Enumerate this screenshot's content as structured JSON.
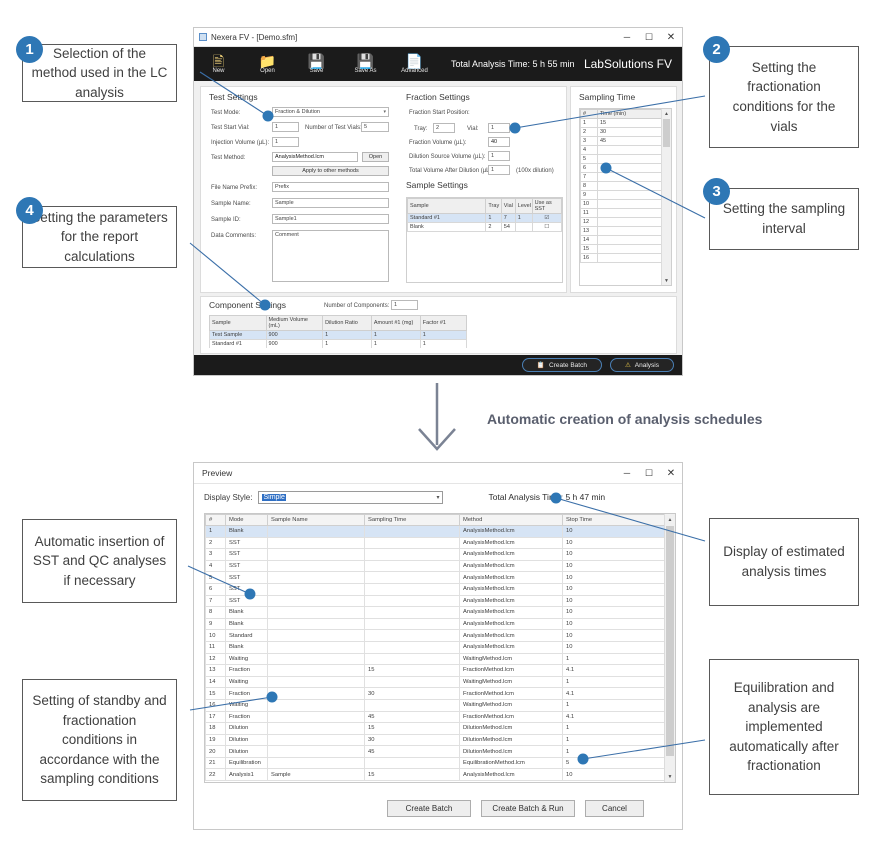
{
  "main_window": {
    "title": "Nexera FV - [Demo.sfm]",
    "window_buttons": {
      "minimize": "─",
      "maximize": "☐",
      "close": "✕"
    },
    "ribbon": {
      "items": [
        {
          "label": "New",
          "icon": "new-document-icon"
        },
        {
          "label": "Open",
          "icon": "folder-open-icon"
        },
        {
          "label": "Save",
          "icon": "floppy-disk-icon"
        },
        {
          "label": "Save As",
          "icon": "floppy-disk-plus-icon"
        },
        {
          "label": "Advanced",
          "icon": "advanced-settings-icon"
        }
      ],
      "total_analysis_time": "Total Analysis Time: 5 h 55 min",
      "brand": "LabSolutions FV"
    },
    "test_settings": {
      "title": "Test Settings",
      "test_mode_label": "Test Mode:",
      "test_mode_value": "Fraction & Dilution",
      "test_start_vial_label": "Test Start Vial:",
      "test_start_vial_value": "1",
      "number_of_test_vials_label": "Number of Test Vials:",
      "number_of_test_vials_value": "5",
      "injection_volume_label": "Injection Volume (µL):",
      "injection_volume_value": "1",
      "test_method_label": "Test Method:",
      "test_method_value": "AnalysisMethod.lcm",
      "open_button": "Open",
      "apply_button": "Apply to other methods",
      "file_name_prefix_label": "File Name Prefix:",
      "file_name_prefix_value": "Prefix",
      "sample_name_label": "Sample Name:",
      "sample_name_value": "Sample",
      "sample_id_label": "Sample ID:",
      "sample_id_value": "Sample1",
      "data_comments_label": "Data Comments:",
      "data_comments_value": "Comment"
    },
    "fraction_settings": {
      "title": "Fraction Settings",
      "start_position_label": "Fraction Start Position:",
      "tray_label": "Tray:",
      "tray_value": "2",
      "vial_label": "Vial:",
      "vial_value": "1",
      "fraction_volume_label": "Fraction Volume (µL):",
      "fraction_volume_value": "40",
      "dilution_source_label": "Dilution Source Volume (µL):",
      "dilution_source_value": "1",
      "total_volume_label": "Total Volume After Dilution (µL):",
      "total_volume_value": "1",
      "dilution_note": "(100x dilution)"
    },
    "sample_settings": {
      "title": "Sample Settings",
      "columns": [
        "Sample",
        "Tray",
        "Vial",
        "Level",
        "Use as SST"
      ],
      "rows": [
        {
          "sample": "Standard #1",
          "tray": "1",
          "vial": "7",
          "level": "1",
          "sst": true,
          "selected": true
        },
        {
          "sample": "Blank",
          "tray": "2",
          "vial": "54",
          "level": "",
          "sst": false,
          "selected": false
        }
      ]
    },
    "sampling_time": {
      "title": "Sampling Time",
      "columns": [
        "#",
        "Time (min)"
      ],
      "rows": [
        {
          "n": "1",
          "time": "15"
        },
        {
          "n": "2",
          "time": "30"
        },
        {
          "n": "3",
          "time": "45"
        },
        {
          "n": "4",
          "time": ""
        },
        {
          "n": "5",
          "time": ""
        },
        {
          "n": "6",
          "time": ""
        },
        {
          "n": "7",
          "time": ""
        },
        {
          "n": "8",
          "time": ""
        },
        {
          "n": "9",
          "time": ""
        },
        {
          "n": "10",
          "time": ""
        },
        {
          "n": "11",
          "time": ""
        },
        {
          "n": "12",
          "time": ""
        },
        {
          "n": "13",
          "time": ""
        },
        {
          "n": "14",
          "time": ""
        },
        {
          "n": "15",
          "time": ""
        },
        {
          "n": "16",
          "time": ""
        }
      ]
    },
    "component_settings": {
      "title": "Component Settings",
      "number_of_components_label": "Number of Components:",
      "number_of_components_value": "1",
      "columns": [
        "Sample",
        "Medium Volume (mL)",
        "Dilution Ratio",
        "Amount #1  (mg)",
        "Factor #1"
      ],
      "rows": [
        {
          "sample": "Test Sample",
          "medium": "900",
          "ratio": "1",
          "amount": "1",
          "factor": "1",
          "selected": true
        },
        {
          "sample": "Standard #1",
          "medium": "900",
          "ratio": "1",
          "amount": "1",
          "factor": "1",
          "selected": false
        }
      ]
    },
    "footer_buttons": [
      {
        "label": "Create Batch",
        "icon": "create-batch-icon"
      },
      {
        "label": "Analysis",
        "icon": "flask-icon"
      }
    ]
  },
  "middle": {
    "arrow_label": "Automatic creation of analysis schedules"
  },
  "preview_window": {
    "title": "Preview",
    "window_buttons": {
      "minimize": "─",
      "maximize": "☐",
      "close": "✕"
    },
    "display_style_label": "Display Style:",
    "display_style_value": "Simple",
    "total_analysis_time": "Total Analysis Time: 5 h 47 min",
    "columns": [
      "#",
      "Mode",
      "Sample Name",
      "Sampling Time",
      "Method",
      "Stop Time"
    ],
    "rows": [
      {
        "n": "1",
        "mode": "Blank",
        "sample": "",
        "sampling": "",
        "method": "AnalysisMethod.lcm",
        "stop": "10",
        "selected": true
      },
      {
        "n": "2",
        "mode": "SST",
        "sample": "",
        "sampling": "",
        "method": "AnalysisMethod.lcm",
        "stop": "10"
      },
      {
        "n": "3",
        "mode": "SST",
        "sample": "",
        "sampling": "",
        "method": "AnalysisMethod.lcm",
        "stop": "10"
      },
      {
        "n": "4",
        "mode": "SST",
        "sample": "",
        "sampling": "",
        "method": "AnalysisMethod.lcm",
        "stop": "10"
      },
      {
        "n": "5",
        "mode": "SST",
        "sample": "",
        "sampling": "",
        "method": "AnalysisMethod.lcm",
        "stop": "10"
      },
      {
        "n": "6",
        "mode": "SST",
        "sample": "",
        "sampling": "",
        "method": "AnalysisMethod.lcm",
        "stop": "10"
      },
      {
        "n": "7",
        "mode": "SST",
        "sample": "",
        "sampling": "",
        "method": "AnalysisMethod.lcm",
        "stop": "10"
      },
      {
        "n": "8",
        "mode": "Blank",
        "sample": "",
        "sampling": "",
        "method": "AnalysisMethod.lcm",
        "stop": "10"
      },
      {
        "n": "9",
        "mode": "Blank",
        "sample": "",
        "sampling": "",
        "method": "AnalysisMethod.lcm",
        "stop": "10"
      },
      {
        "n": "10",
        "mode": "Standard",
        "sample": "",
        "sampling": "",
        "method": "AnalysisMethod.lcm",
        "stop": "10"
      },
      {
        "n": "11",
        "mode": "Blank",
        "sample": "",
        "sampling": "",
        "method": "AnalysisMethod.lcm",
        "stop": "10"
      },
      {
        "n": "12",
        "mode": "Waiting",
        "sample": "",
        "sampling": "",
        "method": "WaitingMethod.lcm",
        "stop": "1"
      },
      {
        "n": "13",
        "mode": "Fraction",
        "sample": "",
        "sampling": "15",
        "method": "FractionMethod.lcm",
        "stop": "4.1"
      },
      {
        "n": "14",
        "mode": "Waiting",
        "sample": "",
        "sampling": "",
        "method": "WaitingMethod.lcm",
        "stop": "1"
      },
      {
        "n": "15",
        "mode": "Fraction",
        "sample": "",
        "sampling": "30",
        "method": "FractionMethod.lcm",
        "stop": "4.1"
      },
      {
        "n": "16",
        "mode": "Waiting",
        "sample": "",
        "sampling": "",
        "method": "WaitingMethod.lcm",
        "stop": "1"
      },
      {
        "n": "17",
        "mode": "Fraction",
        "sample": "",
        "sampling": "45",
        "method": "FractionMethod.lcm",
        "stop": "4.1"
      },
      {
        "n": "18",
        "mode": "Dilution",
        "sample": "",
        "sampling": "15",
        "method": "DilutionMethod.lcm",
        "stop": "1"
      },
      {
        "n": "19",
        "mode": "Dilution",
        "sample": "",
        "sampling": "30",
        "method": "DilutionMethod.lcm",
        "stop": "1"
      },
      {
        "n": "20",
        "mode": "Dilution",
        "sample": "",
        "sampling": "45",
        "method": "DilutionMethod.lcm",
        "stop": "1"
      },
      {
        "n": "21",
        "mode": "Equilibration",
        "sample": "",
        "sampling": "",
        "method": "EquilibrationMethod.lcm",
        "stop": "5"
      },
      {
        "n": "22",
        "mode": "Analysis1",
        "sample": "Sample",
        "sampling": "15",
        "method": "AnalysisMethod.lcm",
        "stop": "10"
      }
    ],
    "footer_buttons": [
      {
        "label": "Create Batch"
      },
      {
        "label": "Create Batch & Run"
      },
      {
        "label": "Cancel"
      }
    ]
  },
  "callouts": [
    {
      "number": "1",
      "text": "Selection of the method used in the LC analysis"
    },
    {
      "number": "2",
      "text": "Setting the fractionation conditions for the vials"
    },
    {
      "number": "3",
      "text": "Setting the sampling interval"
    },
    {
      "number": "4",
      "text": "Setting the parameters for the report calculations"
    },
    {
      "number": "",
      "text": "Automatic insertion of SST and QC analyses if necessary"
    },
    {
      "number": "",
      "text": "Display of estimated analysis times"
    },
    {
      "number": "",
      "text": "Setting of standby and fractionation conditions in accordance with the sampling conditions"
    },
    {
      "number": "",
      "text": "Equilibration and analysis are implemented automatically after fractionation"
    }
  ],
  "colors": {
    "accent": "#2e77b5",
    "leader": "#3b6fa8",
    "ribbon_bg": "#1b1b1b",
    "select_row": "#d6e4f5"
  }
}
